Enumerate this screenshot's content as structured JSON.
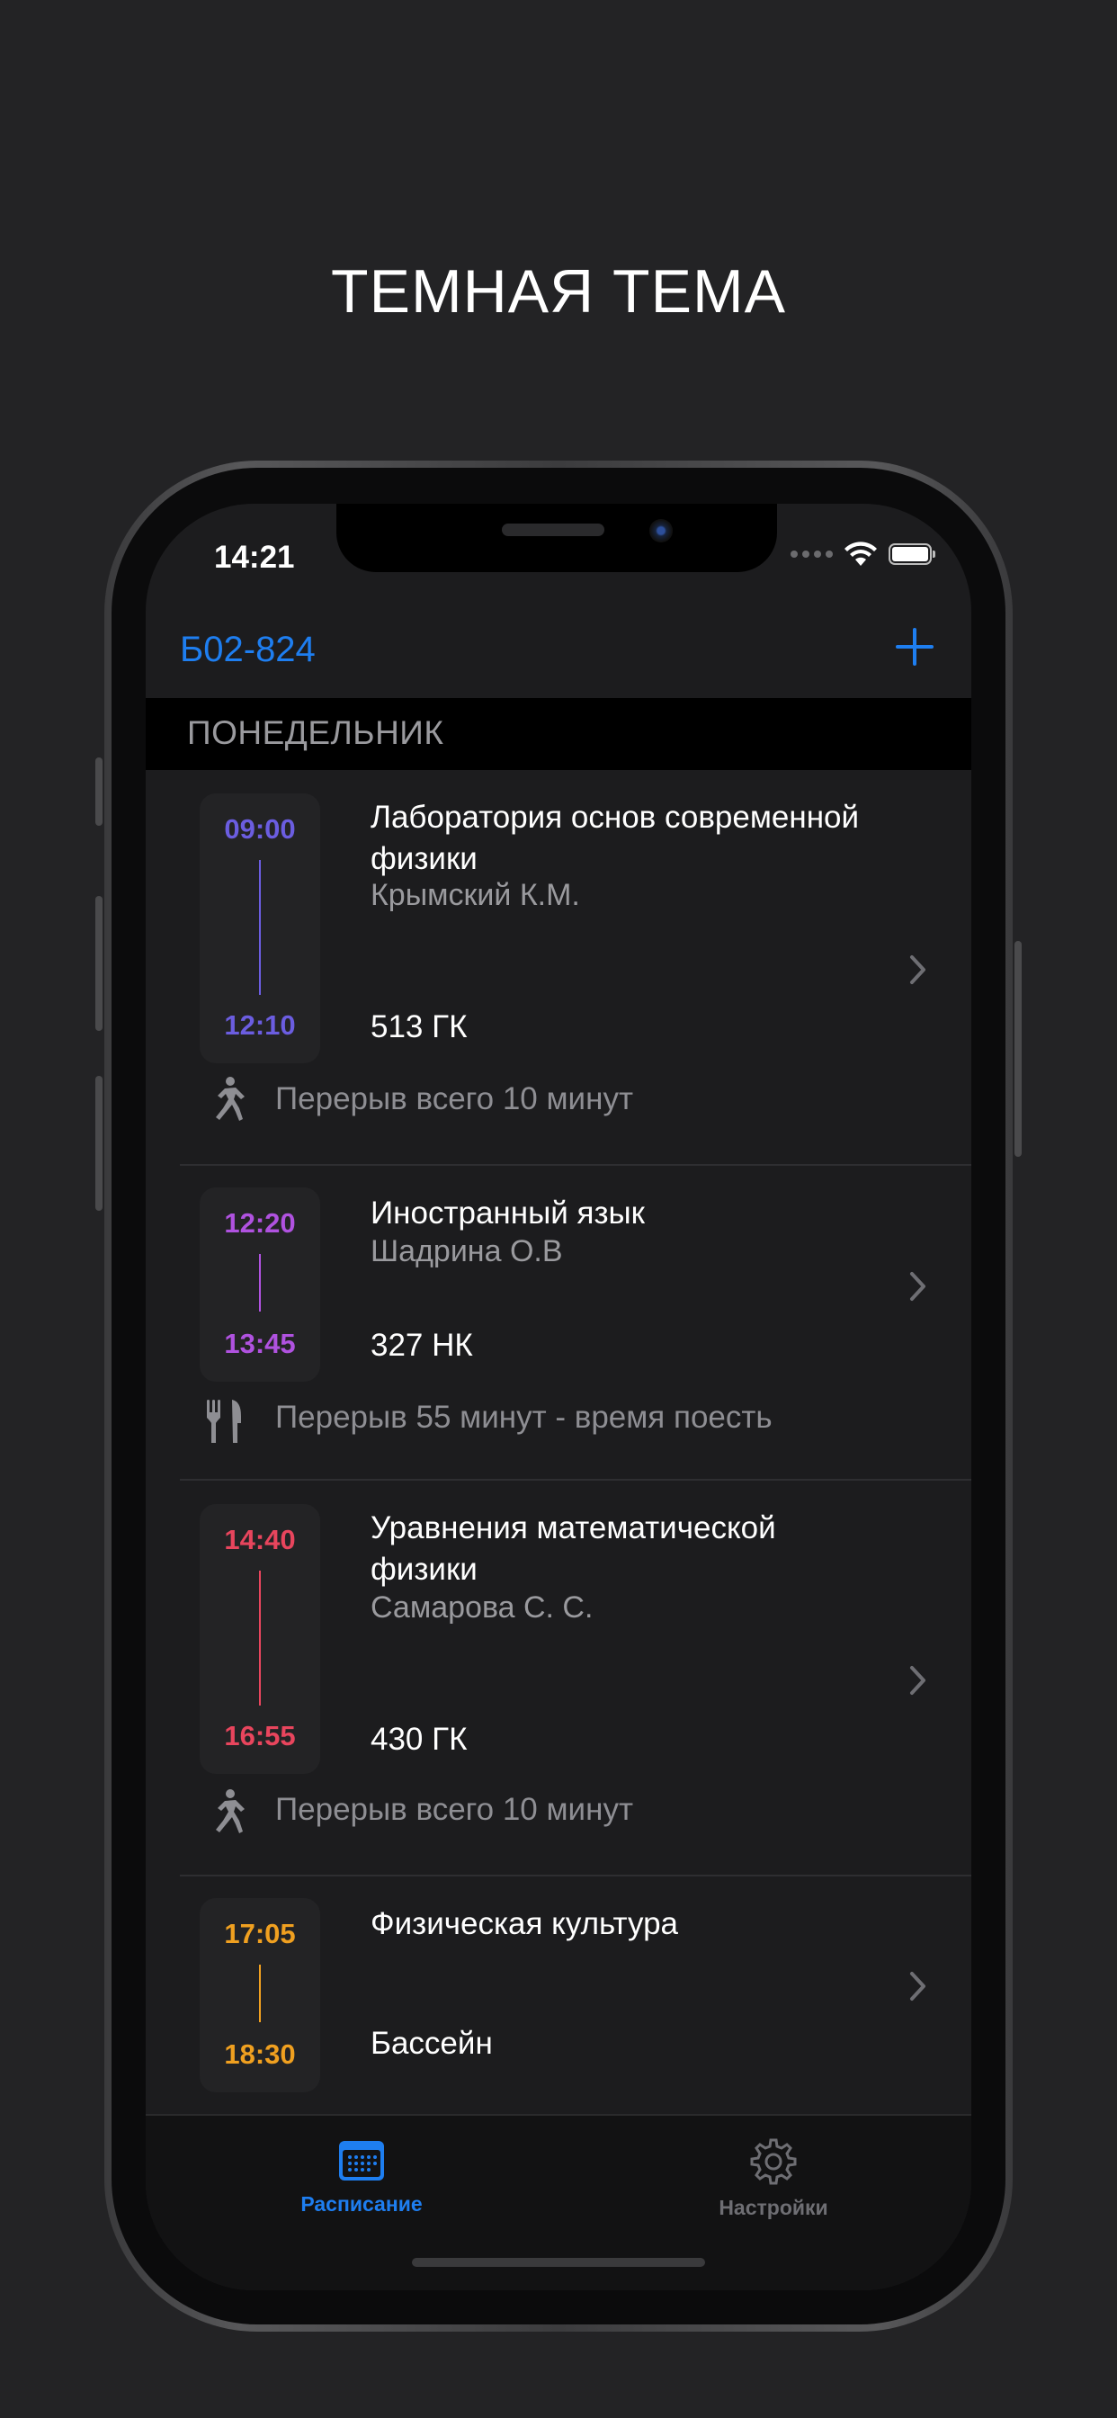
{
  "promo": {
    "title": "ТЕМНАЯ ТЕМА"
  },
  "status_bar": {
    "time": "14:21"
  },
  "navbar": {
    "title": "Б02-824",
    "add_icon": "plus-icon"
  },
  "section": {
    "day": "ПОНЕДЕЛЬНИК"
  },
  "colors": {
    "accent": "#1e7ef0",
    "lesson1": "#6b5de0",
    "lesson2": "#b052e0",
    "lesson3": "#e8455d",
    "lesson4": "#f0a020"
  },
  "lessons": [
    {
      "start": "09:00",
      "end": "12:10",
      "title": "Лаборатория основ современной физики",
      "teacher": "Крымский К.М.",
      "room": "513 ГК"
    },
    {
      "start": "12:20",
      "end": "13:45",
      "title": "Иностранный язык",
      "teacher": "Шадрина О.В",
      "room": "327 НК"
    },
    {
      "start": "14:40",
      "end": "16:55",
      "title": "Уравнения математической физики",
      "teacher": "Самарова С. С.",
      "room": "430 ГК"
    },
    {
      "start": "17:05",
      "end": "18:30",
      "title": "Физическая культура",
      "teacher": "",
      "room": "Бассейн"
    }
  ],
  "breaks": [
    {
      "text": "Перерыв всего 10 минут",
      "icon": "running-person-icon"
    },
    {
      "text": "Перерыв 55 минут - время поесть",
      "icon": "fork-knife-icon"
    },
    {
      "text": "Перерыв всего 10 минут",
      "icon": "running-person-icon"
    }
  ],
  "tabbar": {
    "schedule": {
      "label": "Расписание",
      "icon": "calendar-icon",
      "active": true
    },
    "settings": {
      "label": "Настройки",
      "icon": "gear-icon",
      "active": false
    }
  }
}
